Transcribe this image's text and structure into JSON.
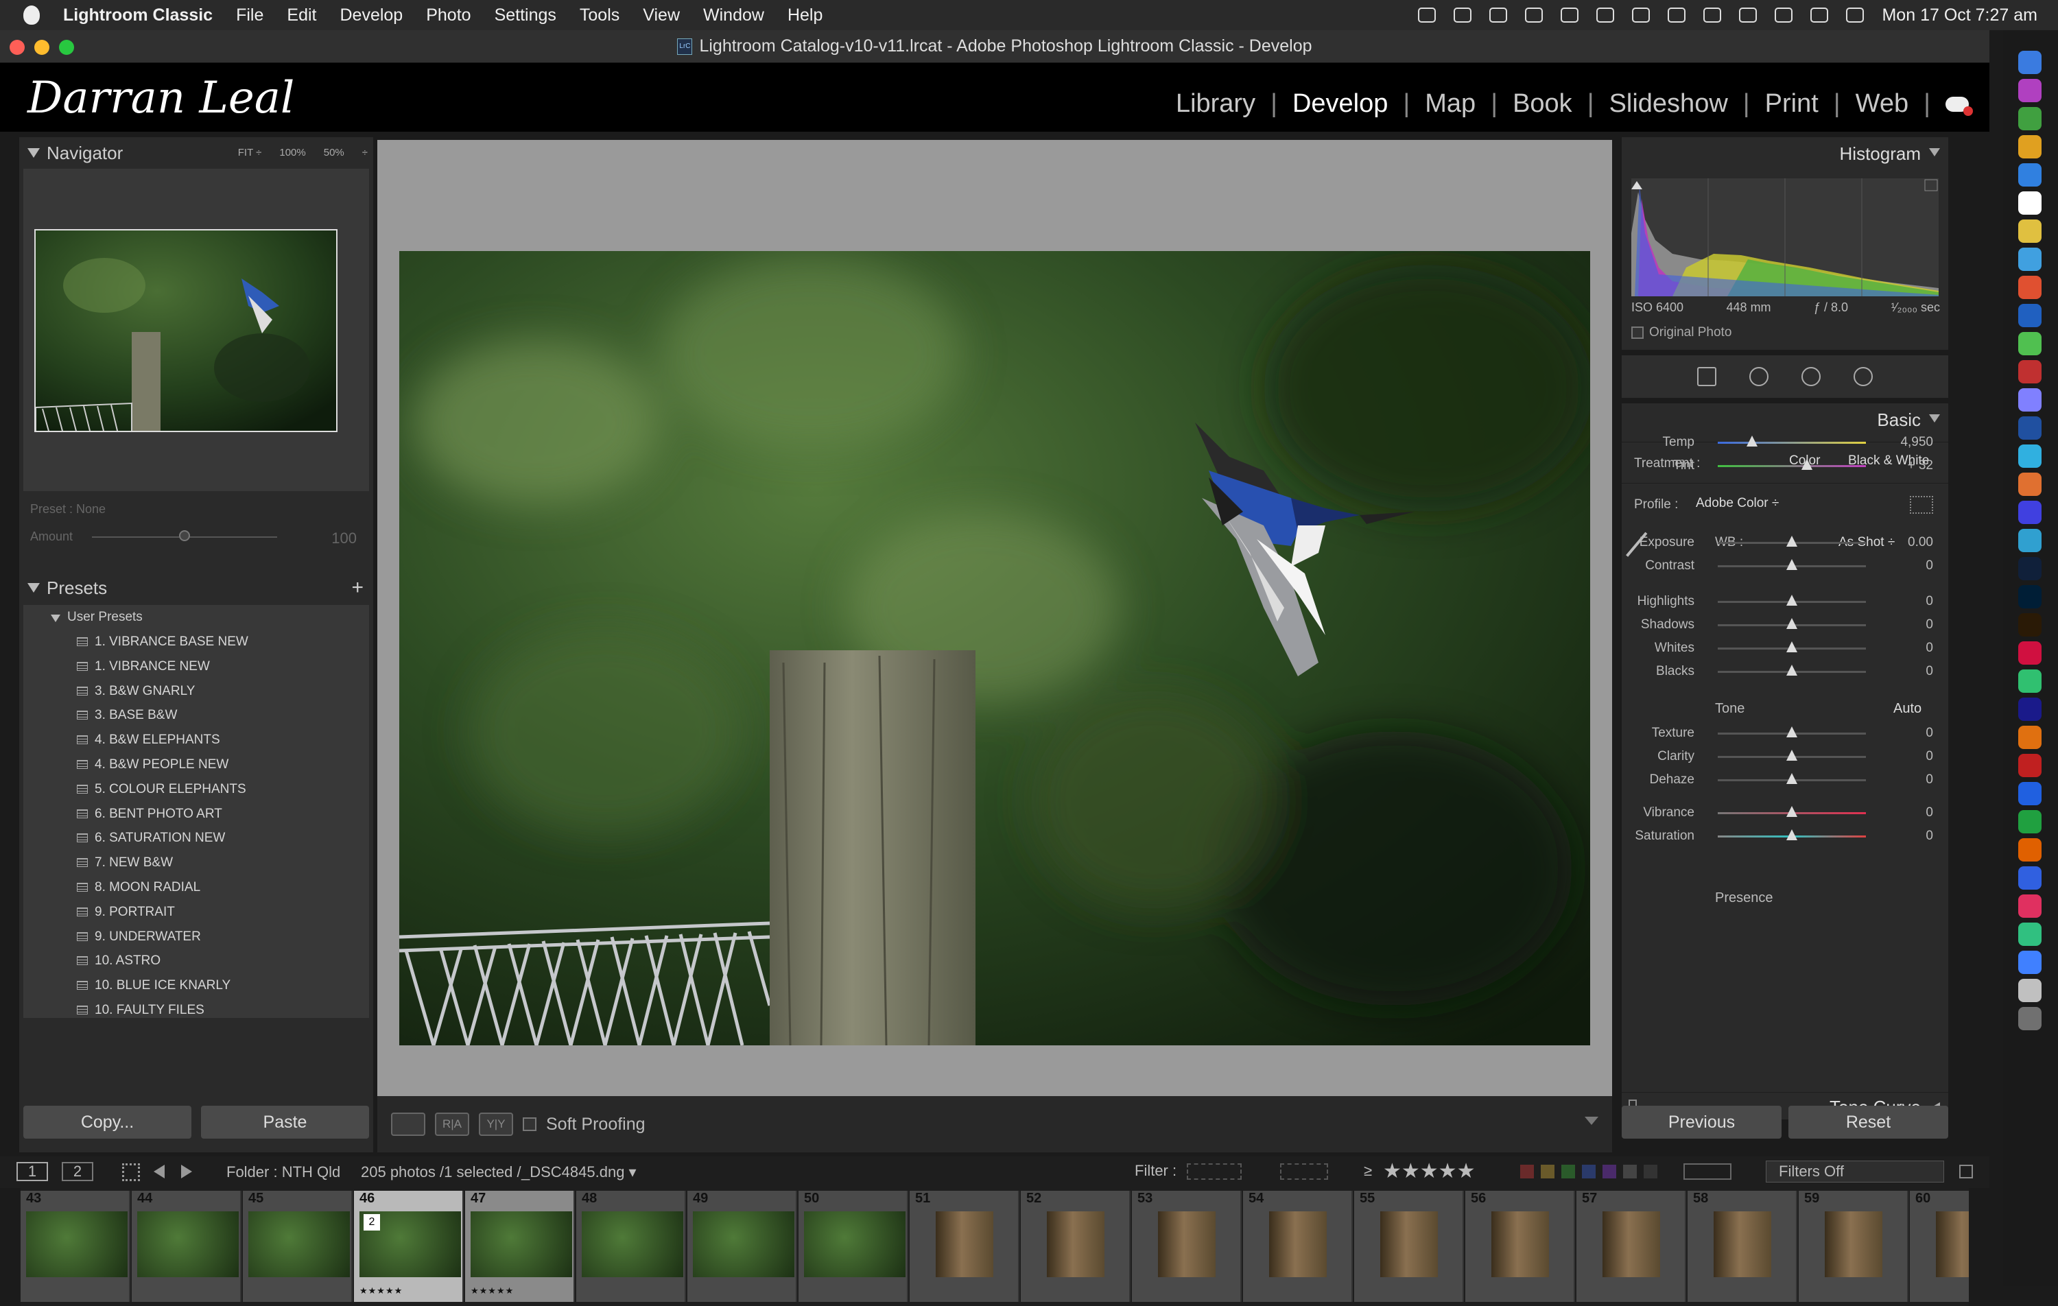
{
  "menubar": {
    "app": "Lightroom Classic",
    "items": [
      "File",
      "Edit",
      "Develop",
      "Photo",
      "Settings",
      "Tools",
      "View",
      "Window",
      "Help"
    ],
    "clock": "Mon 17 Oct  7:27 am"
  },
  "window": {
    "title": "Lightroom Catalog-v10-v11.lrcat - Adobe Photoshop Lightroom Classic - Develop",
    "title_icon": "LrC"
  },
  "identity": {
    "logo": "Darran Leal"
  },
  "modules": [
    "Library",
    "Develop",
    "Map",
    "Book",
    "Slideshow",
    "Print",
    "Web"
  ],
  "navigator": {
    "title": "Navigator",
    "zoom": [
      "FIT ÷",
      "100%",
      "50%",
      "÷"
    ]
  },
  "preset_amount": {
    "label": "Preset : None",
    "amount_label": "Amount",
    "value": "100",
    "level": 0.5
  },
  "presets": {
    "title": "Presets",
    "add": "+",
    "folder": "User Presets",
    "items": [
      "1. VIBRANCE BASE NEW",
      "1. VIBRANCE NEW",
      "3. B&W GNARLY",
      "3. BASE B&W",
      "4. B&W ELEPHANTS",
      "4. B&W PEOPLE NEW",
      "5. COLOUR ELEPHANTS",
      "6. BENT PHOTO ART",
      "6. SATURATION NEW",
      "7. NEW B&W",
      "8. MOON RADIAL",
      "9. PORTRAIT",
      "9. UNDERWATER",
      "10. ASTRO",
      "10. BLUE ICE KNARLY",
      "10. FAULTY FILES"
    ]
  },
  "left_buttons": {
    "copy": "Copy...",
    "paste": "Paste"
  },
  "toolbar": {
    "view": "",
    "ra": "R|A",
    "yy": "Y|Y",
    "soft_proofing": "Soft Proofing"
  },
  "histogram": {
    "title": "Histogram",
    "iso": "ISO 6400",
    "focal": "448 mm",
    "aperture": "ƒ / 8.0",
    "shutter": "¹⁄₂₀₀₀ sec",
    "original": "Original Photo"
  },
  "basic": {
    "title": "Basic",
    "treatment_label": "Treatment :",
    "treatment_color": "Color",
    "treatment_bw": "Black & White",
    "profile_label": "Profile :",
    "profile": "Adobe Color ÷",
    "wb_label": "WB :",
    "wb": "As Shot ÷",
    "tone": "Tone",
    "auto": "Auto",
    "presence": "Presence",
    "sliders": [
      {
        "label": "Temp",
        "value": "4,950",
        "level": 0.23
      },
      {
        "label": "Tint",
        "value": "+ 32",
        "level": 0.6
      },
      {
        "label": "Exposure",
        "value": "0.00",
        "level": 0.5
      },
      {
        "label": "Contrast",
        "value": "0",
        "level": 0.5
      },
      {
        "label": "Highlights",
        "value": "0",
        "level": 0.5
      },
      {
        "label": "Shadows",
        "value": "0",
        "level": 0.5
      },
      {
        "label": "Whites",
        "value": "0",
        "level": 0.5
      },
      {
        "label": "Blacks",
        "value": "0",
        "level": 0.5
      },
      {
        "label": "Texture",
        "value": "0",
        "level": 0.5
      },
      {
        "label": "Clarity",
        "value": "0",
        "level": 0.5
      },
      {
        "label": "Dehaze",
        "value": "0",
        "level": 0.5
      },
      {
        "label": "Vibrance",
        "value": "0",
        "level": 0.5
      },
      {
        "label": "Saturation",
        "value": "0",
        "level": 0.5
      }
    ],
    "tone_curve": "Tone Curve"
  },
  "right_buttons": {
    "previous": "Previous",
    "reset": "Reset"
  },
  "filmbar": {
    "page1": "1",
    "page2": "2",
    "folder": "Folder : NTH Qld",
    "count": "205 photos /1 selected /",
    "filename": "_DSC4845.dng ▾",
    "filter_label": "Filter :",
    "rating_op": "≥",
    "stars": "★★★★★",
    "filters_off": "Filters Off"
  },
  "film_cells": [
    {
      "num": "43",
      "stars": ""
    },
    {
      "num": "44",
      "stars": ""
    },
    {
      "num": "45",
      "stars": ""
    },
    {
      "num": "46",
      "stars": "★★★★★",
      "badge": "2"
    },
    {
      "num": "47",
      "stars": "★★★★★"
    },
    {
      "num": "48",
      "stars": ""
    },
    {
      "num": "49",
      "stars": ""
    },
    {
      "num": "50",
      "stars": ""
    },
    {
      "num": "51",
      "stars": ""
    },
    {
      "num": "52",
      "stars": ""
    },
    {
      "num": "53",
      "stars": ""
    },
    {
      "num": "54",
      "stars": ""
    },
    {
      "num": "55",
      "stars": ""
    },
    {
      "num": "56",
      "stars": ""
    },
    {
      "num": "57",
      "stars": ""
    },
    {
      "num": "58",
      "stars": ""
    },
    {
      "num": "59",
      "stars": ""
    },
    {
      "num": "60",
      "stars": ""
    }
  ]
}
